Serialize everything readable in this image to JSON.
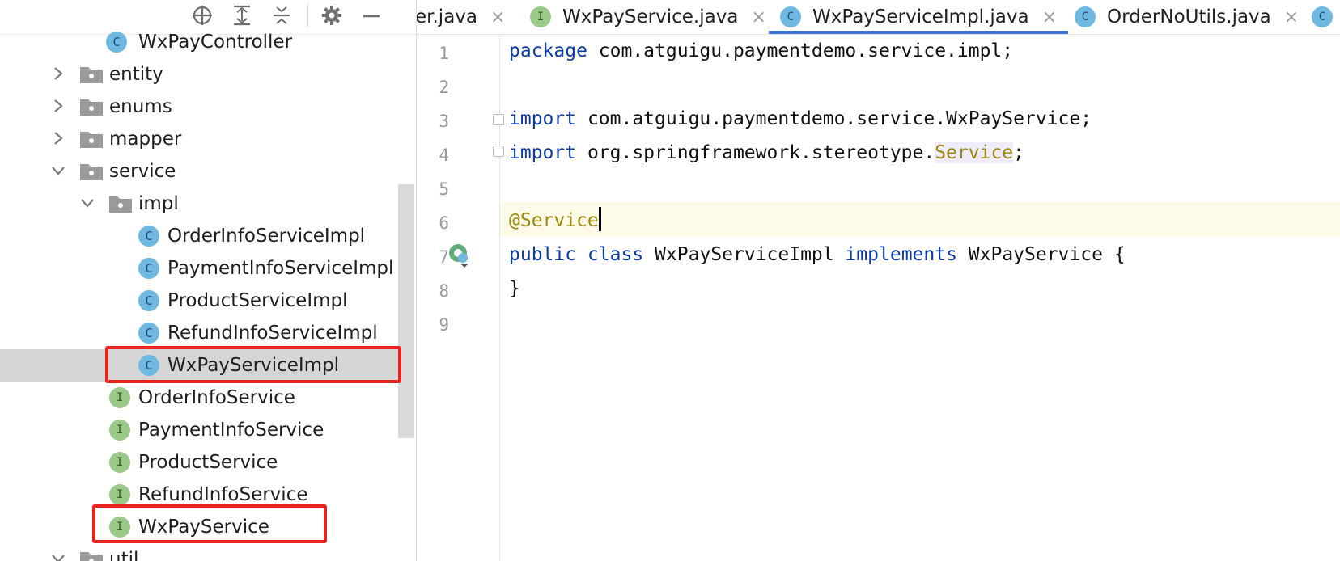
{
  "toolbar": {
    "icons": [
      "locate-icon",
      "expand-all-icon",
      "collapse-all-icon",
      "settings-icon",
      "hide-icon"
    ]
  },
  "tree": {
    "items": [
      {
        "label": "WxPayController",
        "kind": "class"
      },
      {
        "label": "entity",
        "kind": "folder",
        "expanded": false
      },
      {
        "label": "enums",
        "kind": "folder",
        "expanded": false
      },
      {
        "label": "mapper",
        "kind": "folder",
        "expanded": false
      },
      {
        "label": "service",
        "kind": "folder",
        "expanded": true
      },
      {
        "label": "impl",
        "kind": "folder",
        "expanded": true
      },
      {
        "label": "OrderInfoServiceImpl",
        "kind": "class"
      },
      {
        "label": "PaymentInfoServiceImpl",
        "kind": "class"
      },
      {
        "label": "ProductServiceImpl",
        "kind": "class"
      },
      {
        "label": "RefundInfoServiceImpl",
        "kind": "class"
      },
      {
        "label": "WxPayServiceImpl",
        "kind": "class",
        "selected": true,
        "highlighted": true
      },
      {
        "label": "OrderInfoService",
        "kind": "interface"
      },
      {
        "label": "PaymentInfoService",
        "kind": "interface"
      },
      {
        "label": "ProductService",
        "kind": "interface"
      },
      {
        "label": "RefundInfoService",
        "kind": "interface"
      },
      {
        "label": "WxPayService",
        "kind": "interface",
        "highlighted": true
      },
      {
        "label": "util",
        "kind": "folder",
        "expanded": true
      }
    ],
    "class_icon_letter": "C",
    "interface_icon_letter": "I"
  },
  "tabs": [
    {
      "label": "er.java",
      "close": "×"
    },
    {
      "label": "WxPayService.java",
      "icon": "I",
      "close": "×"
    },
    {
      "label": "WxPayServiceImpl.java",
      "icon": "C",
      "close": "×",
      "active": true
    },
    {
      "label": "OrderNoUtils.java",
      "icon": "C",
      "close": "×"
    }
  ],
  "editor": {
    "line_numbers": [
      "1",
      "2",
      "3",
      "4",
      "5",
      "6",
      "7",
      "8",
      "9"
    ],
    "current_line": 6,
    "code": {
      "l1_kw": "package",
      "l1_rest": " com.atguigu.paymentdemo.service.impl;",
      "l3_kw": "import",
      "l3_rest": " com.atguigu.paymentdemo.service.WxPayService;",
      "l4_kw": "import",
      "l4_rest": " org.springframework.stereotype.",
      "l4_hl": "Service",
      "l4_end": ";",
      "l6_ann": "@Service",
      "l7_kw1": "public",
      "l7_kw2": "class",
      "l7_name": " WxPayServiceImpl ",
      "l7_kw3": "implements",
      "l7_rest": " WxPayService {",
      "l8": "}"
    }
  },
  "colors": {
    "highlight_box": "#e8231d",
    "keyword": "#0b3aa8",
    "annotation": "#9e880d",
    "active_tab_underline": "#3c74d6",
    "selected_row": "#d5d5d5"
  }
}
